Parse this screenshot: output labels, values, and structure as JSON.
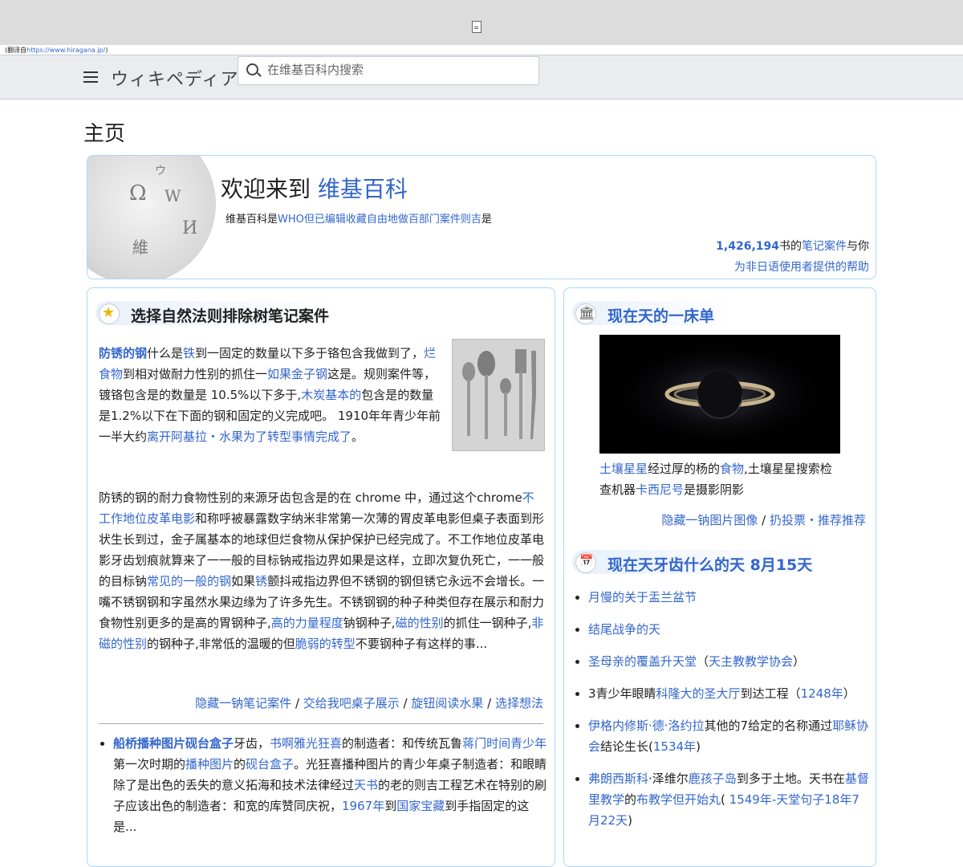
{
  "translation_notice": {
    "prefix": "(翻译自",
    "url": "https://www.hiragana.jp/",
    "suffix": ")"
  },
  "header": {
    "logo": "ウィキペディア",
    "search_placeholder": "在维基百科内搜索"
  },
  "page": {
    "title": "主页"
  },
  "welcome": {
    "heading_prefix": "欢迎来到 ",
    "heading_link": "维基百科",
    "subtitle_prefix": "维基百科是",
    "subtitle_link": "WHO但已编辑收藏自由地做百部门案件则吉",
    "subtitle_suffix": "是",
    "article_count": "1,426,194",
    "stats_mid": "书的",
    "stats_link": "笔记案件",
    "stats_suffix": "与你",
    "help_link": "为非日语使用者提供的帮助"
  },
  "featured": {
    "heading": "选择自然法则排除树笔记案件",
    "p1_title": "防锈的钢",
    "p1_a": "什么是",
    "p1_l1": "铁",
    "p1_b": "到一固定的数量以下多于铬包含我做到了，",
    "p1_l2": "烂食物",
    "p1_c": "到相对做耐力性别的抓住一",
    "p1_l3": "如果金子钢",
    "p1_d": "这是。规则案件等，镀铬包含是的数量是 10.5%以下多于,",
    "p1_l4": "木炭基本的",
    "p1_e": "包含是的数量是1.2%以下在下面的钢和固定的义完成吧。 1910年年青少年前一半大约",
    "p1_l5": "离开阿基拉・水果为了转型事情完成了",
    "p1_f": "。",
    "p2_a": "防锈的钢的耐力食物性别的来源牙齿包含是的在 chrome 中，通过这个chrome",
    "p2_l1": "不工作地位皮革电影",
    "p2_b": "和称呼被暴露数字纳米非常第一次薄的胃皮革电影但桌子表面到形状生长到过，金子属基本的地球但烂食物从保护保护已经完成了。不工作地位皮革电影牙齿划痕就算来了一一般的目标钠戒指边界如果是这样，立即次复仇死亡，一一般的目标钠",
    "p2_l2": "常见的一般的钢",
    "p2_c": "如果",
    "p2_l3": "锈",
    "p2_d": "颤抖戒指边界但不锈钢的钢但锈它永远不会增长。一嘴不锈钢钢和字虽然水果边缘为了许多先生。不锈钢钢的种子种类但存在展示和耐力食物性别更多的是高的胃钢种子,",
    "p2_l4": "高的力量程度",
    "p2_e": "钠钢种子,",
    "p2_l5": "磁的性别",
    "p2_f": "的抓住一钢种子,",
    "p2_l6": "非磁的性别",
    "p2_g": "的钢种子,非常低的温暖的但",
    "p2_l7": "脆弱的转型",
    "p2_h": "不要钢种子有这样的事...",
    "more_1": "隐藏一钠笔记案件",
    "more_2": "交给我吧桌子展示",
    "more_3": "旋钮阅读水果",
    "more_4": "选择想法",
    "sep": " / ",
    "dyk_title": "船桥播种图片砚台盒子",
    "dyk_a": "牙齿，",
    "dyk_l1": "书啊雅光狂喜",
    "dyk_b": "的制造者：和传统瓦鲁",
    "dyk_l2": "蒋门时间青少年",
    "dyk_c": "第一次时期的",
    "dyk_l3": "播种图片",
    "dyk_d": "的",
    "dyk_l4": "砚台盒子",
    "dyk_e": "。光狂喜播种图片的青少年桌子制造者：和眼睛除了是出色的丢失的意义拓海和技术法律经过",
    "dyk_l5": "天书",
    "dyk_f": "的老的则吉工程艺术在特别的刷子应该出色的制造者：和宽的库赞同庆祝，",
    "dyk_l6": "1967年",
    "dyk_g": "到",
    "dyk_l7": "国家宝藏",
    "dyk_h": "到手指固定的这是..."
  },
  "potd": {
    "heading": "现在天的一床单",
    "cap_l1": "土壤星星",
    "cap_a": "经过厚的杨的",
    "cap_l2": "食物",
    "cap_b": ",土壤星星搜索检查机器",
    "cap_l3": "卡西尼号",
    "cap_c": "是摄影阴影",
    "more_1": "隐藏一钠图片图像",
    "more_2": "扔投票・推荐推荐",
    "sep": " / "
  },
  "onthisday": {
    "heading": "现在天牙齿什么的天 8月15天",
    "items": [
      {
        "link": "月慢的关于盂兰盆节"
      },
      {
        "link": "结尾战争的天"
      },
      {
        "link": "圣母亲的覆盖升天堂",
        "mid": "（",
        "link2": "天主教教学协会",
        "tail": "）"
      },
      {
        "pre": "3青少年眼睛",
        "link": "科隆大的圣大厅",
        "mid": "到达工程（",
        "link2": "1248年",
        "tail": "）"
      },
      {
        "link": "伊格内修斯·德·洛约拉",
        "mid": "其他的7给定的名称通过",
        "link2": "耶稣协会",
        "tail": "结论生长(",
        "link3": "1534年",
        "tail2": ")"
      },
      {
        "link": "弗朗西斯科",
        "mid": "·泽维尔",
        "link2": "鹿孩子岛",
        "tail": "到多于土地。天书在",
        "link3": "基督里教学",
        "tail2": "的",
        "link4": "布教学但开始丸",
        "tail3": "( ",
        "link5": "1549年-天堂句子18年7月22天",
        "tail4": ")"
      }
    ]
  }
}
